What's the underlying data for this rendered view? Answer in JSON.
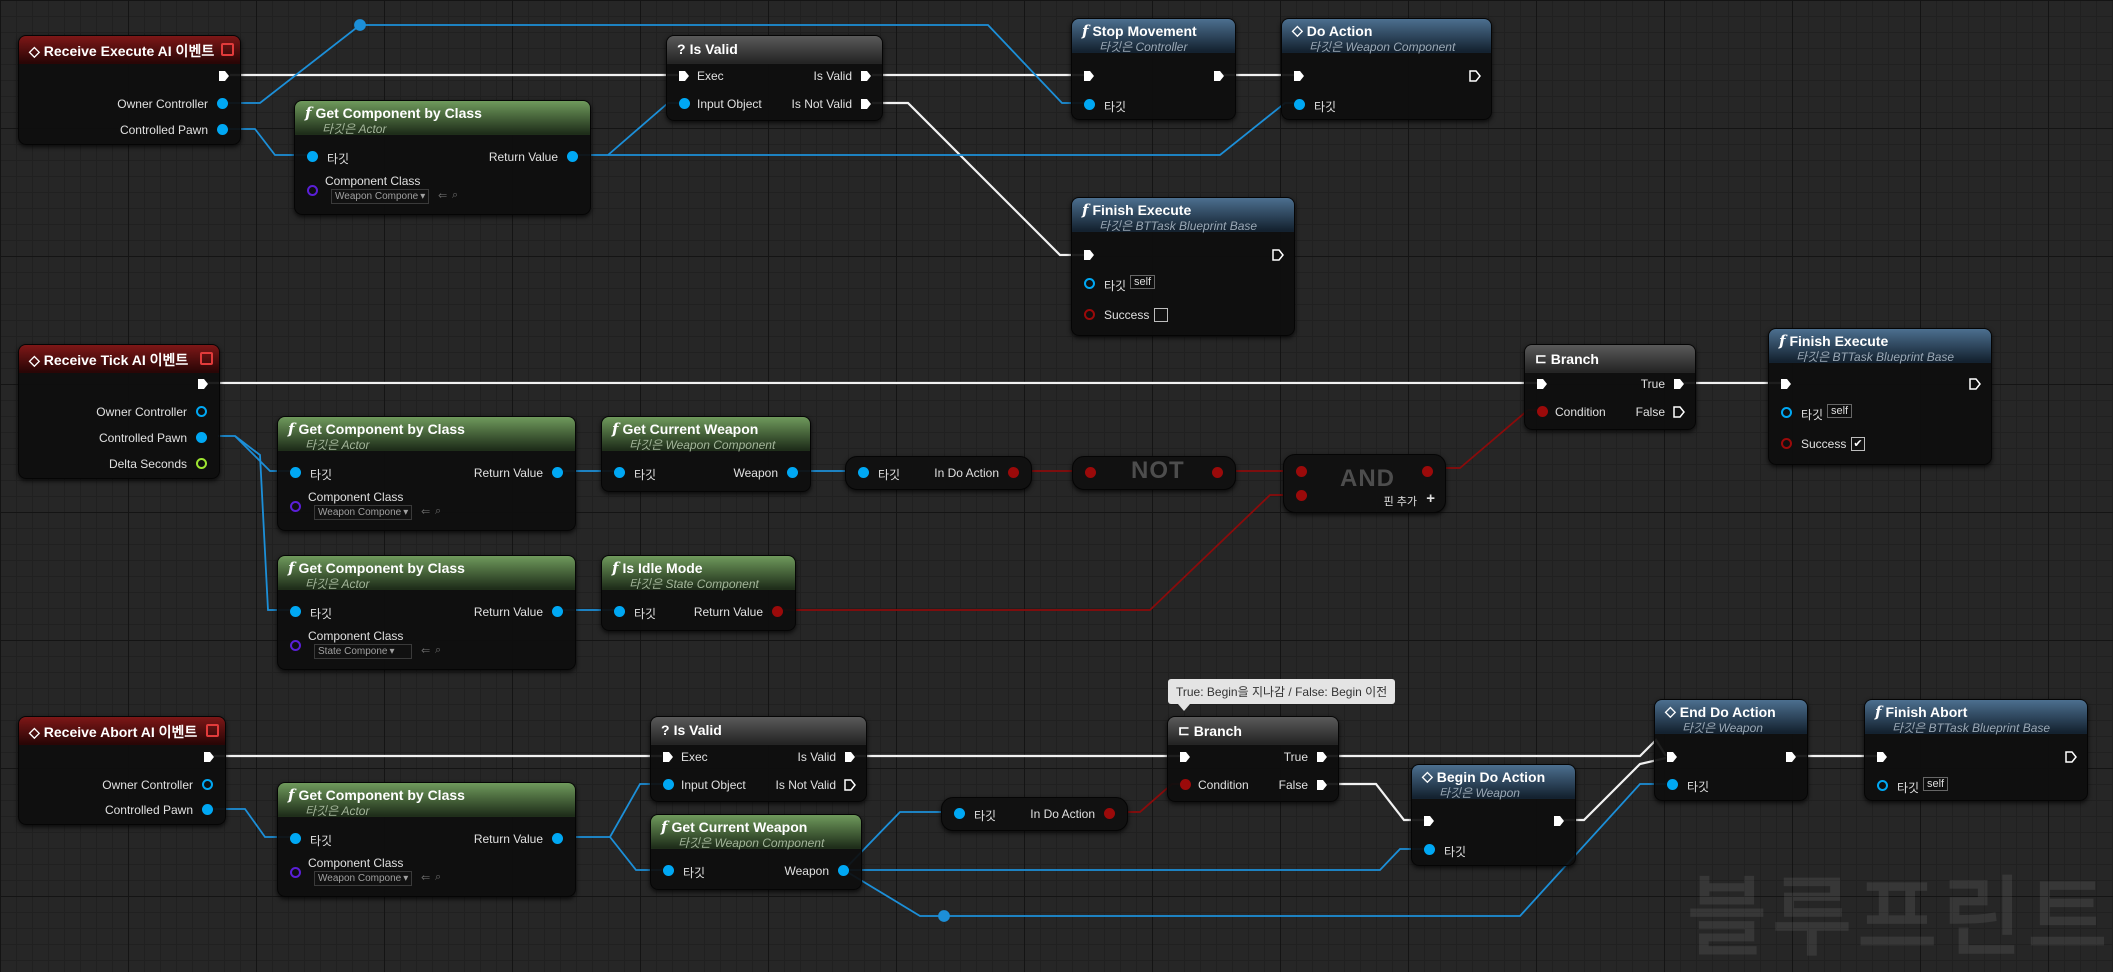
{
  "watermark": "블루프린트",
  "comment": "True: Begin을 지나감 / False: Begin 이전",
  "row1": {
    "event": {
      "title": "Receive Execute AI 이벤트",
      "owner": "Owner Controller",
      "pawn": "Controlled Pawn"
    },
    "getcomp": {
      "title": "Get Component by Class",
      "sub": "타깃은 Actor",
      "target": "타깃",
      "ret": "Return Value",
      "cls": "Component Class",
      "val": "Weapon Compone"
    },
    "isvalid": {
      "title": "Is Valid",
      "exec": "Exec",
      "input": "Input Object",
      "valid": "Is Valid",
      "notvalid": "Is Not Valid"
    },
    "stop": {
      "title": "Stop Movement",
      "sub": "타깃은 Controller",
      "target": "타깃"
    },
    "doaction": {
      "title": "Do Action",
      "sub": "타깃은 Weapon Component",
      "target": "타깃"
    },
    "finish": {
      "title": "Finish Execute",
      "sub": "타깃은 BTTask Blueprint Base",
      "target": "타깃",
      "self": "self",
      "success": "Success"
    }
  },
  "row2": {
    "event": {
      "title": "Receive Tick AI 이벤트",
      "owner": "Owner Controller",
      "pawn": "Controlled Pawn",
      "delta": "Delta Seconds"
    },
    "getcomp1": {
      "title": "Get Component by Class",
      "sub": "타깃은 Actor",
      "target": "타깃",
      "ret": "Return Value",
      "cls": "Component Class",
      "val": "Weapon Compone"
    },
    "getweapon": {
      "title": "Get Current Weapon",
      "sub": "타깃은 Weapon Component",
      "target": "타깃",
      "weapon": "Weapon"
    },
    "indo": {
      "target": "타깃",
      "label": "In Do Action"
    },
    "not": {
      "label": "NOT"
    },
    "and": {
      "label": "AND",
      "addpin": "핀 추가"
    },
    "getcomp2": {
      "title": "Get Component by Class",
      "sub": "타깃은 Actor",
      "target": "타깃",
      "ret": "Return Value",
      "cls": "Component Class",
      "val": "State Compone"
    },
    "idle": {
      "title": "Is Idle Mode",
      "sub": "타깃은 State Component",
      "target": "타깃",
      "ret": "Return Value"
    },
    "branch": {
      "title": "Branch",
      "cond": "Condition",
      "t": "True",
      "f": "False"
    },
    "finish": {
      "title": "Finish Execute",
      "sub": "타깃은 BTTask Blueprint Base",
      "target": "타깃",
      "self": "self",
      "success": "Success",
      "checked": "✔"
    }
  },
  "row3": {
    "event": {
      "title": "Receive Abort AI 이벤트",
      "owner": "Owner Controller",
      "pawn": "Controlled Pawn"
    },
    "getcomp": {
      "title": "Get Component by Class",
      "sub": "타깃은 Actor",
      "target": "타깃",
      "ret": "Return Value",
      "cls": "Component Class",
      "val": "Weapon Compone"
    },
    "isvalid": {
      "title": "Is Valid",
      "exec": "Exec",
      "input": "Input Object",
      "valid": "Is Valid",
      "notvalid": "Is Not Valid"
    },
    "getweapon": {
      "title": "Get Current Weapon",
      "sub": "타깃은 Weapon Component",
      "target": "타깃",
      "weapon": "Weapon"
    },
    "indo": {
      "target": "타깃",
      "label": "In Do Action"
    },
    "branch": {
      "title": "Branch",
      "cond": "Condition",
      "t": "True",
      "f": "False"
    },
    "begin": {
      "title": "Begin Do Action",
      "sub": "타깃은 Weapon",
      "target": "타깃"
    },
    "end": {
      "title": "End Do Action",
      "sub": "타깃은 Weapon",
      "target": "타깃"
    },
    "abort": {
      "title": "Finish Abort",
      "sub": "타깃은 BTTask Blueprint Base",
      "target": "타깃",
      "self": "self"
    }
  },
  "colors": {
    "exec": "#ffffff",
    "object": "#00a8f4",
    "bool": "#9b0a0a",
    "class": "#5a1fd6",
    "float": "#9ee531",
    "event_header": "#7e1717",
    "pure_header": "#6f9a5c",
    "call_header": "#4c6f8f"
  }
}
